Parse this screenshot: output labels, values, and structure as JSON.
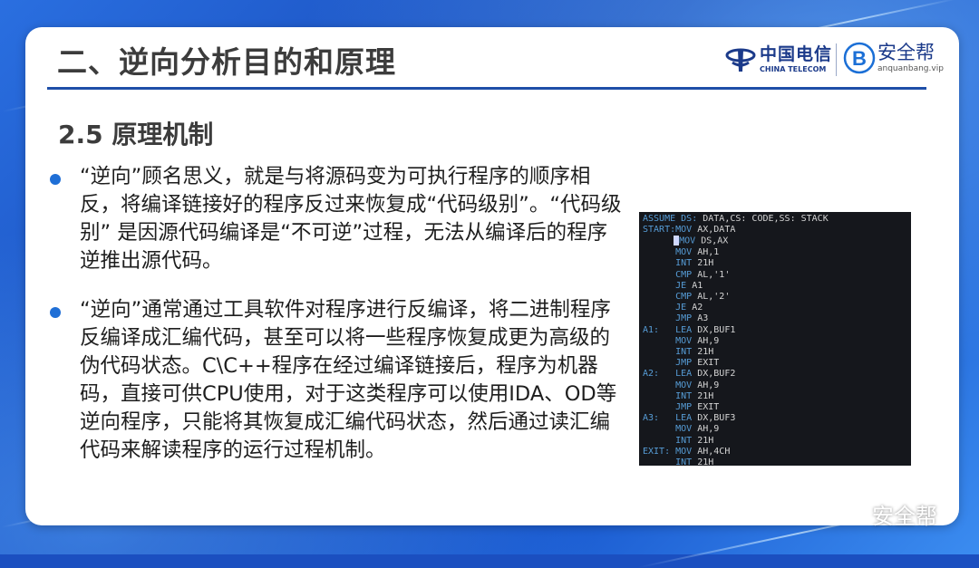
{
  "slide": {
    "title": "二、逆向分析目的和原理",
    "section_title": "2.5 原理机制",
    "logos": {
      "telecom_cn": "中国电信",
      "telecom_en": "CHINA TELECOM",
      "brand_cn": "安全帮",
      "brand_url": "anquanbang.vip"
    },
    "bullets": [
      "“逆向”顾名思义，就是与将源码变为可执行程序的顺序相反，将编译链接好的程序反过来恢复成“代码级别”。“代码级别” 是因源代码编译是“不可逆”过程，无法从编译后的程序逆推出源代码。",
      "“逆向”通常通过工具软件对程序进行反编译，将二进制程序反编译成汇编代码，甚至可以将一些程序恢复成更为高级的伪代码状态。C\\C++程序在经过编译链接后，程序为机器码，直接可供CPU使用，对于这类程序可以使用IDA、OD等逆向程序，只能将其恢复成汇编代码状态，然后通过读汇编代码来解读程序的运行过程机制。"
    ],
    "code_lines": [
      {
        "label": "ASSUME",
        "op": "DS:",
        "args": "DATA,CS: CODE,SS: STACK"
      },
      {
        "label": "START:",
        "op": "MOV",
        "args": "AX,DATA"
      },
      {
        "label": "",
        "op": "MOV",
        "args": "DS,AX",
        "cursor": true
      },
      {
        "label": "",
        "op": "MOV",
        "args": "AH,1"
      },
      {
        "label": "",
        "op": "INT",
        "args": "21H"
      },
      {
        "label": "",
        "op": "CMP",
        "args": "AL,'1'"
      },
      {
        "label": "",
        "op": "JE",
        "args": "A1"
      },
      {
        "label": "",
        "op": "CMP",
        "args": "AL,'2'"
      },
      {
        "label": "",
        "op": "JE",
        "args": "A2"
      },
      {
        "label": "",
        "op": "JMP",
        "args": "A3"
      },
      {
        "label": "A1:",
        "op": "LEA",
        "args": "DX,BUF1"
      },
      {
        "label": "",
        "op": "MOV",
        "args": "AH,9"
      },
      {
        "label": "",
        "op": "INT",
        "args": "21H"
      },
      {
        "label": "",
        "op": "JMP",
        "args": "EXIT"
      },
      {
        "label": "A2:",
        "op": "LEA",
        "args": "DX,BUF2"
      },
      {
        "label": "",
        "op": "MOV",
        "args": "AH,9"
      },
      {
        "label": "",
        "op": "INT",
        "args": "21H"
      },
      {
        "label": "",
        "op": "JMP",
        "args": "EXIT"
      },
      {
        "label": "A3:",
        "op": "LEA",
        "args": "DX,BUF3"
      },
      {
        "label": "",
        "op": "MOV",
        "args": "AH,9"
      },
      {
        "label": "",
        "op": "INT",
        "args": "21H"
      },
      {
        "label": "EXIT:",
        "op": "MOV",
        "args": "AH,4CH"
      },
      {
        "label": "",
        "op": "INT",
        "args": "21H"
      }
    ],
    "watermark": "安全帮"
  },
  "colors": {
    "accent": "#1f6fd6",
    "header_rule": "#1f4fa8",
    "code_bg": "#15171c",
    "code_keyword": "#569cd6"
  }
}
